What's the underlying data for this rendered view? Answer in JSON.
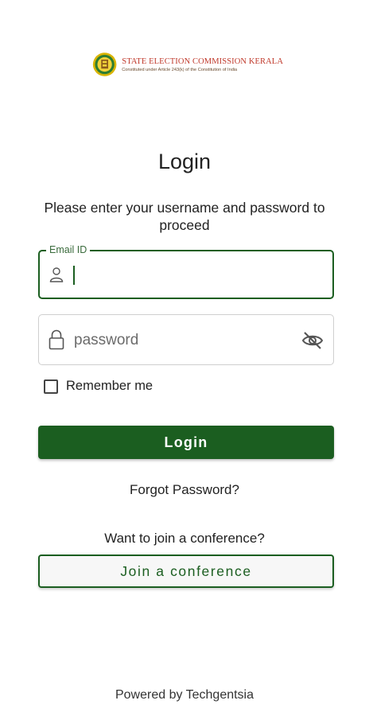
{
  "logo": {
    "title": "STATE ELECTION COMMISSION KERALA",
    "subtitle": "Constituted under Article 243(k) of the Constitution of India",
    "seal_icon": "election-commission-seal"
  },
  "page": {
    "title": "Login",
    "instructions": "Please enter your username and password to proceed"
  },
  "email_field": {
    "label": "Email ID",
    "value": "",
    "icon": "user-icon"
  },
  "password_field": {
    "placeholder": "password",
    "value": "",
    "icon": "lock-icon",
    "toggle_icon": "eye-off-icon"
  },
  "remember": {
    "label": "Remember me",
    "checked": false
  },
  "buttons": {
    "login": "Login",
    "forgot_password": "Forgot Password?",
    "join_prompt": "Want to join a conference?",
    "join_conference": "Join a conference"
  },
  "footer": {
    "powered_by": "Powered by Techgentsia"
  },
  "colors": {
    "primary": "#1b5e20",
    "brand_red": "#c0392b",
    "background": "#ffffff"
  }
}
